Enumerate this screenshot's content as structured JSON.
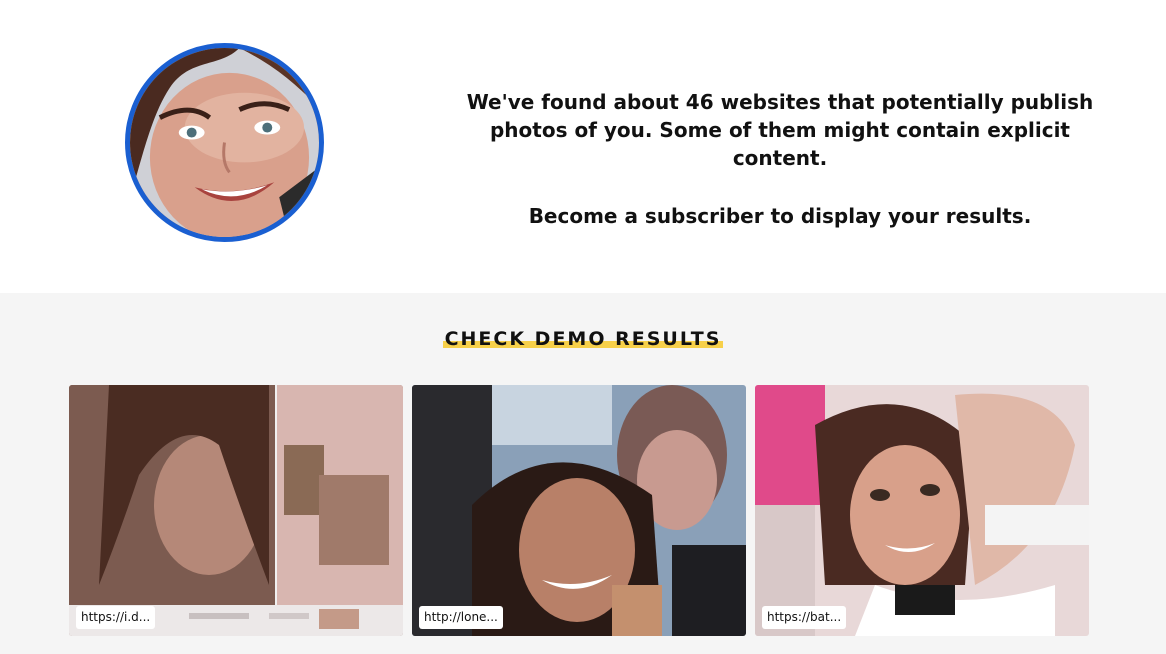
{
  "header": {
    "message_line1": "We've found about 46 websites that potentially publish photos of you. Some of them might contain explicit content.",
    "message_line2": "Become a subscriber to display your results."
  },
  "demo": {
    "title": "CHECK DEMO RESULTS",
    "results": [
      {
        "url": "https://i.d..."
      },
      {
        "url": "http://lone..."
      },
      {
        "url": "https://bat..."
      }
    ]
  },
  "colors": {
    "avatar_border": "#1a5fd1",
    "highlight": "#f7d04a",
    "section_bg": "#f5f5f5"
  }
}
